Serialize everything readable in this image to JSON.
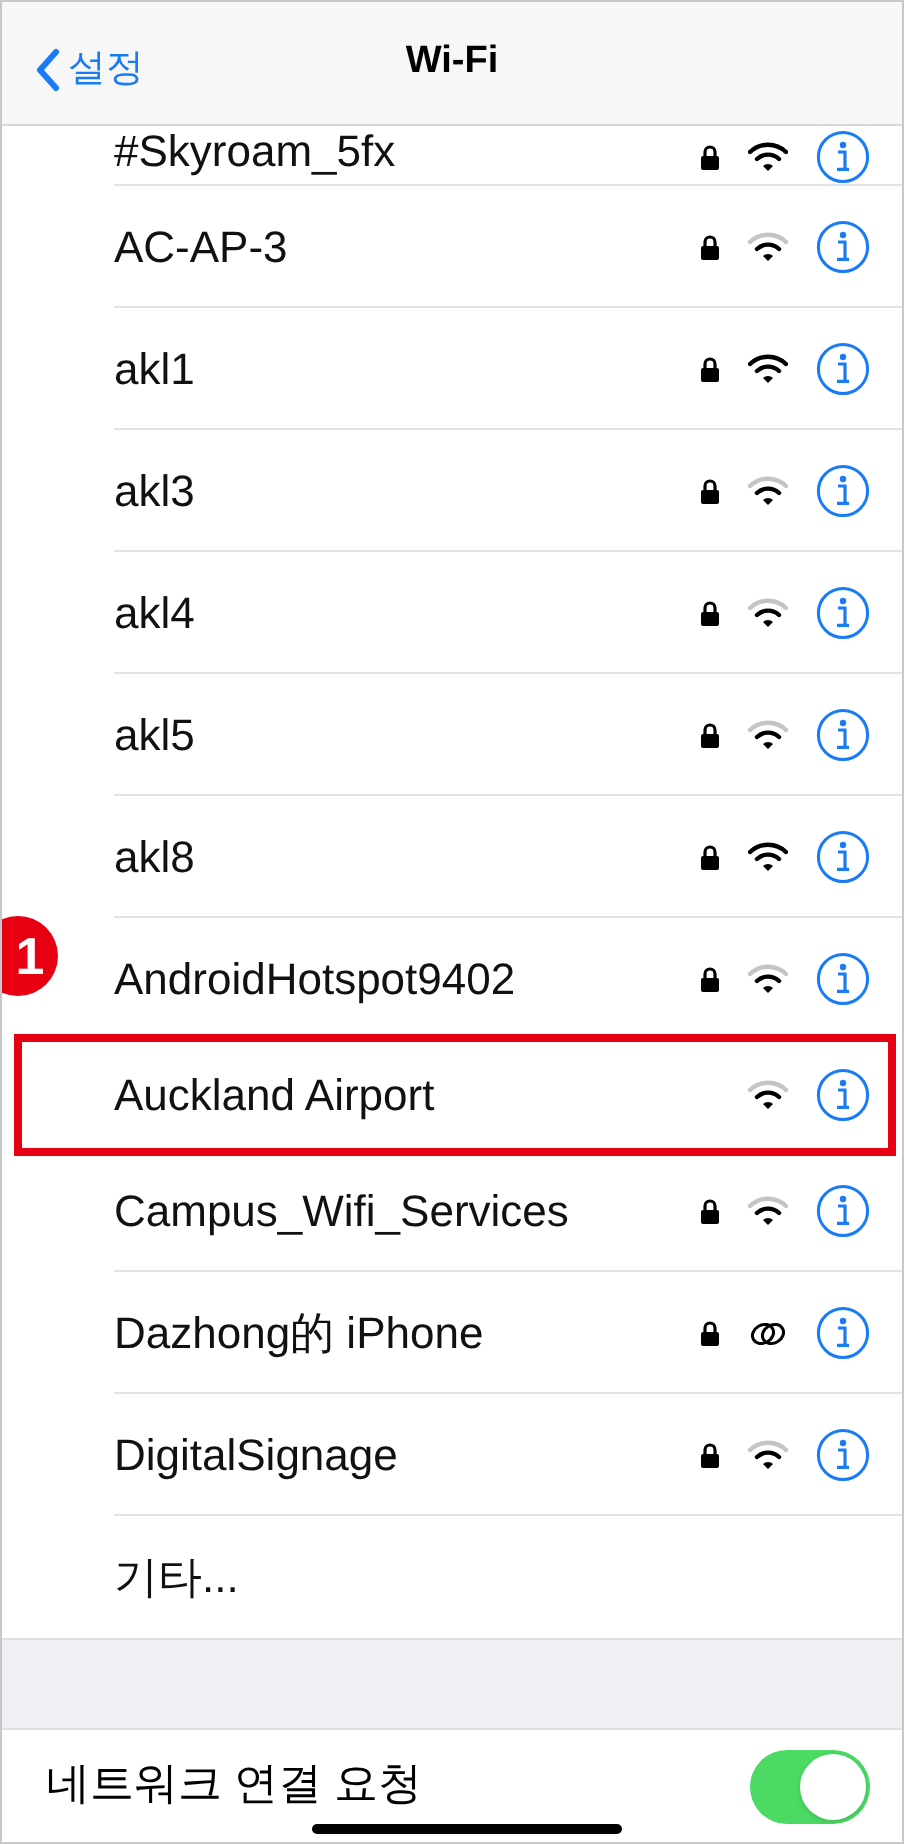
{
  "nav_bar": {
    "back_label": "설정",
    "title": "Wi-Fi"
  },
  "networks": [
    {
      "name": "#Skyroam_5fx",
      "locked": true,
      "kind": "wifi-strong",
      "highlighted": false
    },
    {
      "name": "AC-AP-3",
      "locked": true,
      "kind": "wifi-weak",
      "highlighted": false
    },
    {
      "name": "akl1",
      "locked": true,
      "kind": "wifi-strong",
      "highlighted": false
    },
    {
      "name": "akl3",
      "locked": true,
      "kind": "wifi-weak",
      "highlighted": false
    },
    {
      "name": "akl4",
      "locked": true,
      "kind": "wifi-weak",
      "highlighted": false
    },
    {
      "name": "akl5",
      "locked": true,
      "kind": "wifi-weak",
      "highlighted": false
    },
    {
      "name": "akl8",
      "locked": true,
      "kind": "wifi-strong",
      "highlighted": false
    },
    {
      "name": "AndroidHotspot9402",
      "locked": true,
      "kind": "wifi-weak",
      "highlighted": false
    },
    {
      "name": "Auckland Airport",
      "locked": false,
      "kind": "wifi-weak",
      "highlighted": true,
      "badge": "1"
    },
    {
      "name": "Campus_Wifi_Services",
      "locked": true,
      "kind": "wifi-weak",
      "highlighted": false
    },
    {
      "name": "Dazhong的 iPhone",
      "locked": true,
      "kind": "hotspot",
      "highlighted": false
    },
    {
      "name": "DigitalSignage",
      "locked": true,
      "kind": "wifi-weak",
      "highlighted": false
    },
    {
      "name": "기타...",
      "kind": "other",
      "highlighted": false
    }
  ],
  "ask_to_join": {
    "label": "네트워크 연결 요청",
    "on": true
  }
}
